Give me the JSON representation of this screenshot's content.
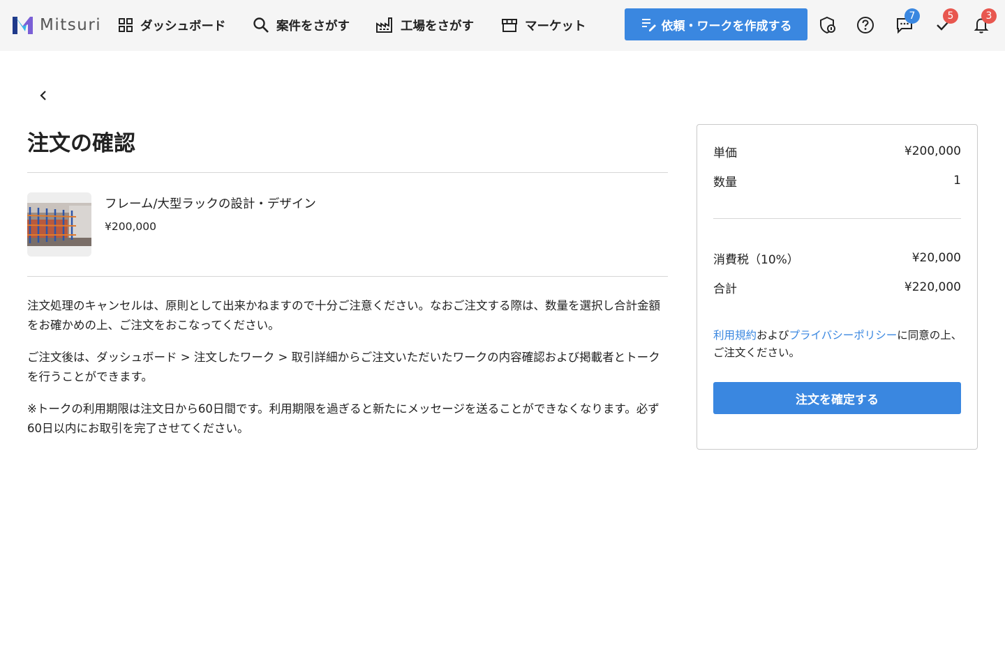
{
  "header": {
    "brand": "Mitsuri",
    "nav": {
      "dashboard": "ダッシュボード",
      "search_projects": "案件をさがす",
      "search_factories": "工場をさがす",
      "market": "マーケット"
    },
    "create_button": "依頼・ワークを作成する",
    "badges": {
      "messages": "7",
      "tasks": "5",
      "notifications": "3"
    },
    "colors": {
      "accent": "#3a87e0",
      "badge_red": "#e8574f",
      "background": "#f5f5f5"
    },
    "icons": [
      "dashboard-grid-icon",
      "search-icon",
      "factory-icon",
      "store-icon",
      "edit-note-icon",
      "shield-icon",
      "help-icon",
      "chat-icon",
      "check-icon",
      "bell-icon"
    ]
  },
  "page": {
    "title": "注文の確認",
    "product": {
      "name": "フレーム/大型ラックの設計・デザイン",
      "price": "¥200,000"
    },
    "notes": [
      "注文処理のキャンセルは、原則として出来かねますので十分ご注意ください。なおご注文する際は、数量を選択し合計金額をお確かめの上、ご注文をおこなってください。",
      "ご注文後は、ダッシュボード > 注文したワーク > 取引詳細からご注文いただいたワークの内容確認および掲載者とトークを行うことができます。",
      "※トークの利用期限は注文日から60日間です。利用期限を過ぎると新たにメッセージを送ることができなくなります。必ず60日以内にお取引を完了させてください。"
    ]
  },
  "summary": {
    "unit_price_label": "単価",
    "unit_price_value": "¥200,000",
    "quantity_label": "数量",
    "quantity_value": "1",
    "tax_label": "消費税（10%）",
    "tax_value": "¥20,000",
    "total_label": "合計",
    "total_value": "¥220,000",
    "terms_link": "利用規約",
    "and_text": "および",
    "privacy_link": "プライバシーポリシー",
    "agree_text": "に同意の上、ご注文ください。",
    "confirm_button": "注文を確定する"
  }
}
